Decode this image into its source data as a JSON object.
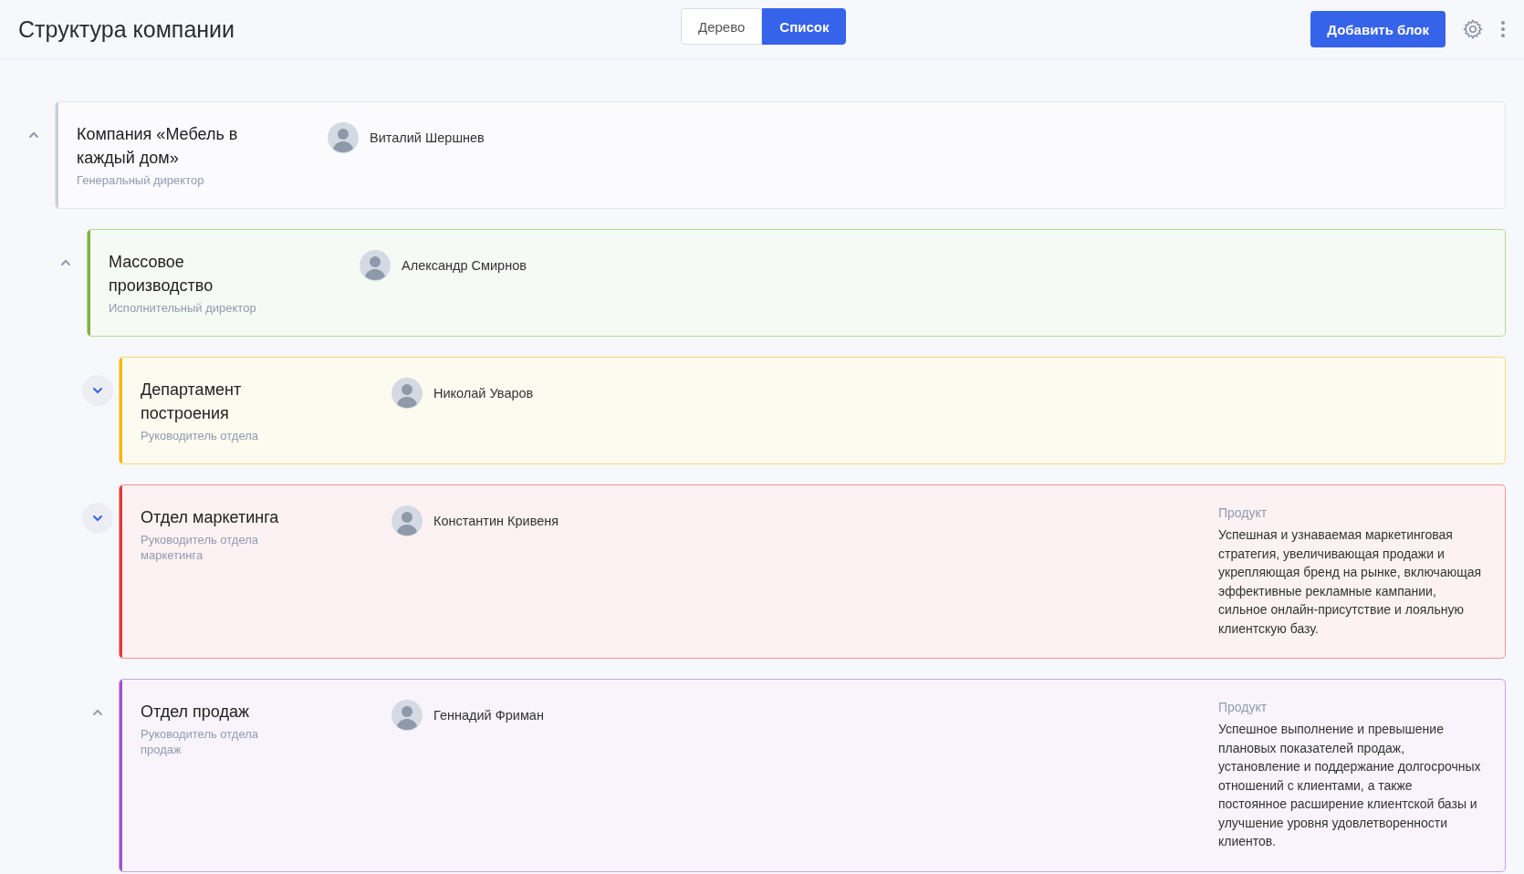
{
  "header": {
    "title": "Структура компании",
    "view_switch": [
      {
        "label": "Дерево",
        "selected": false
      },
      {
        "label": "Список",
        "selected": true
      }
    ],
    "add_button": "Добавить блок"
  },
  "structure": [
    {
      "title": "Компания «Мебель в каждый дом»",
      "role": "Генеральный директор",
      "person": "Виталий Шершнев",
      "color": "#c9d0db",
      "expanded": true,
      "children": [
        {
          "title": "Массовое производство",
          "role": "Исполнительный директор",
          "person": "Александр Смирнов",
          "color": "#7cb342",
          "expanded": true,
          "children": [
            {
              "title": "Департамент построения",
              "role": "Руководитель отдела",
              "person": "Николай Уваров",
              "color": "#f5b50a",
              "expanded": false
            },
            {
              "title": "Отдел маркетинга",
              "role": "Руководитель отдела маркетинга",
              "person": "Константин Кривеня",
              "color": "#e53935",
              "expanded": false,
              "product_label": "Продукт",
              "product": "Успешная и узнаваемая маркетинговая стратегия, увеличивающая продажи и укрепляющая бренд на рынке, включающая эффективные рекламные кампании, сильное онлайн-присутствие и лояльную клиентскую базу."
            },
            {
              "title": "Отдел продаж",
              "role": "Руководитель отдела продаж",
              "person": "Геннадий Фриман",
              "color": "#a352cc",
              "expanded": true,
              "product_label": "Продукт",
              "product": "Успешное выполнение и превышение плановых показателей продаж, установление и поддержание долгосрочных отношений с клиентами, а также постоянное расширение клиентской базы и улучшение уровня удовлетворенности клиентов."
            }
          ]
        }
      ]
    }
  ]
}
